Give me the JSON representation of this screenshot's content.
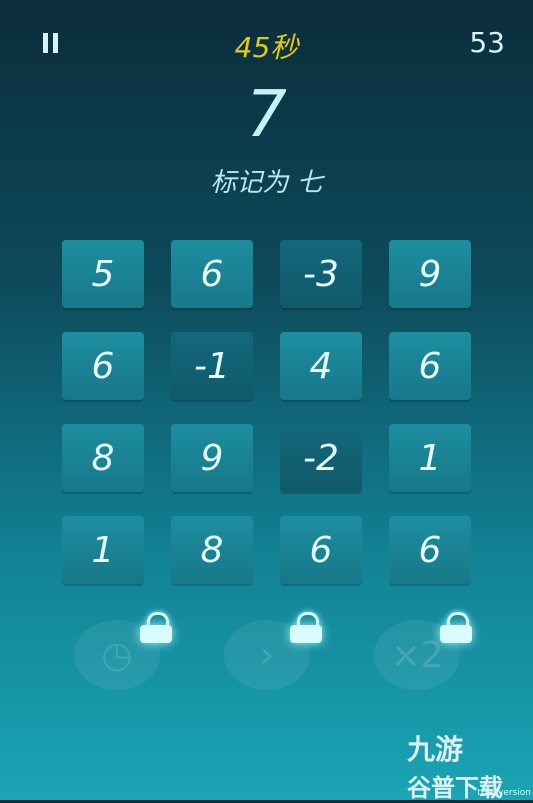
{
  "hud": {
    "timer": "45秒",
    "score": "53"
  },
  "target": {
    "number": "7",
    "instruction": "标记为 七"
  },
  "grid": [
    [
      "5",
      "6",
      "-3",
      "9"
    ],
    [
      "6",
      "-1",
      "4",
      "6"
    ],
    [
      "8",
      "9",
      "-2",
      "1"
    ],
    [
      "1",
      "8",
      "6",
      "6"
    ]
  ],
  "powerups": [
    {
      "icon": "clock-icon",
      "locked": true
    },
    {
      "icon": "skip-icon",
      "locked": true
    },
    {
      "icon": "multiplier-icon",
      "label": "×2",
      "locked": true
    }
  ],
  "watermark": {
    "line1": "九游",
    "line2": "谷普下载",
    "trial": "trial version"
  }
}
